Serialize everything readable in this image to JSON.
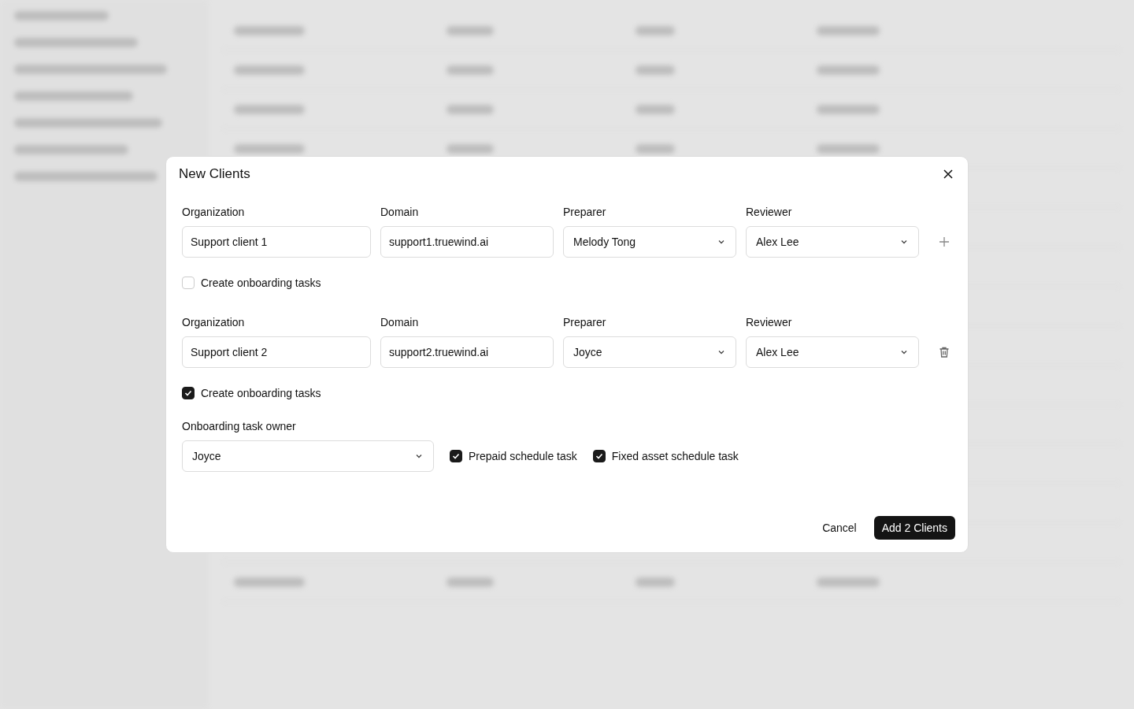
{
  "dialog": {
    "title": "New Clients",
    "clients": [
      {
        "fields": [
          {
            "label": "Organization",
            "kind": "text",
            "value": "Support client 1"
          },
          {
            "label": "Domain",
            "kind": "text",
            "value": "support1.truewind.ai"
          },
          {
            "label": "Preparer",
            "kind": "select",
            "value": "Melody Tong"
          },
          {
            "label": "Reviewer",
            "kind": "select",
            "value": "Alex Lee"
          }
        ],
        "action": {
          "kind": "add"
        },
        "onboarding": {
          "label": "Create onboarding tasks",
          "checked": false
        }
      },
      {
        "fields": [
          {
            "label": "Organization",
            "kind": "text",
            "value": "Support client 2"
          },
          {
            "label": "Domain",
            "kind": "text",
            "value": "support2.truewind.ai"
          },
          {
            "label": "Preparer",
            "kind": "select",
            "value": "Joyce"
          },
          {
            "label": "Reviewer",
            "kind": "select",
            "value": "Alex Lee"
          }
        ],
        "action": {
          "kind": "delete"
        },
        "onboarding": {
          "label": "Create onboarding tasks",
          "checked": true,
          "owner": {
            "label": "Onboarding task owner",
            "value": "Joyce"
          },
          "tasks": [
            {
              "label": "Prepaid schedule task",
              "checked": true
            },
            {
              "label": "Fixed asset schedule task",
              "checked": true
            }
          ]
        }
      }
    ],
    "buttons": [
      {
        "label": "Cancel",
        "kind": "secondary"
      },
      {
        "label": "Add 2 Clients",
        "kind": "primary"
      }
    ]
  }
}
